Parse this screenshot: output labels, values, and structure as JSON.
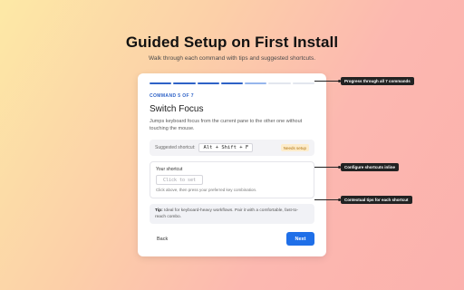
{
  "header": {
    "title": "Guided Setup on First Install",
    "subtitle": "Walk through each command with tips and suggested shortcuts."
  },
  "wizard": {
    "step_label": "COMMAND 5 OF 7",
    "progress": {
      "completed": 4,
      "current": 5,
      "total": 7
    },
    "command_title": "Switch Focus",
    "command_description": "Jumps keyboard focus from the current pane to the other one without touching the mouse.",
    "suggested_label": "Suggested shortcut:",
    "suggested_keys": "Alt + Shift + F",
    "needs_setup_badge": "Needs setup",
    "your_shortcut_label": "Your shortcut",
    "click_to_set": "Click to set",
    "your_shortcut_hint": "Click above, then press your preferred key combination.",
    "tip_prefix": "Tip:",
    "tip_text": "Ideal for keyboard-heavy workflows. Pair it with a comfortable, fast-to-reach combo.",
    "back_label": "Back",
    "next_label": "Next"
  },
  "callouts": {
    "progress": "Progress through all 7 commands",
    "configure": "Configure shortcuts inline",
    "tips": "Contextual tips for each shortcut"
  },
  "colors": {
    "accent": "#1f6fe8",
    "progress_done": "#2e62c7",
    "badge_text": "#b07412",
    "badge_bg": "#fdeccb"
  }
}
